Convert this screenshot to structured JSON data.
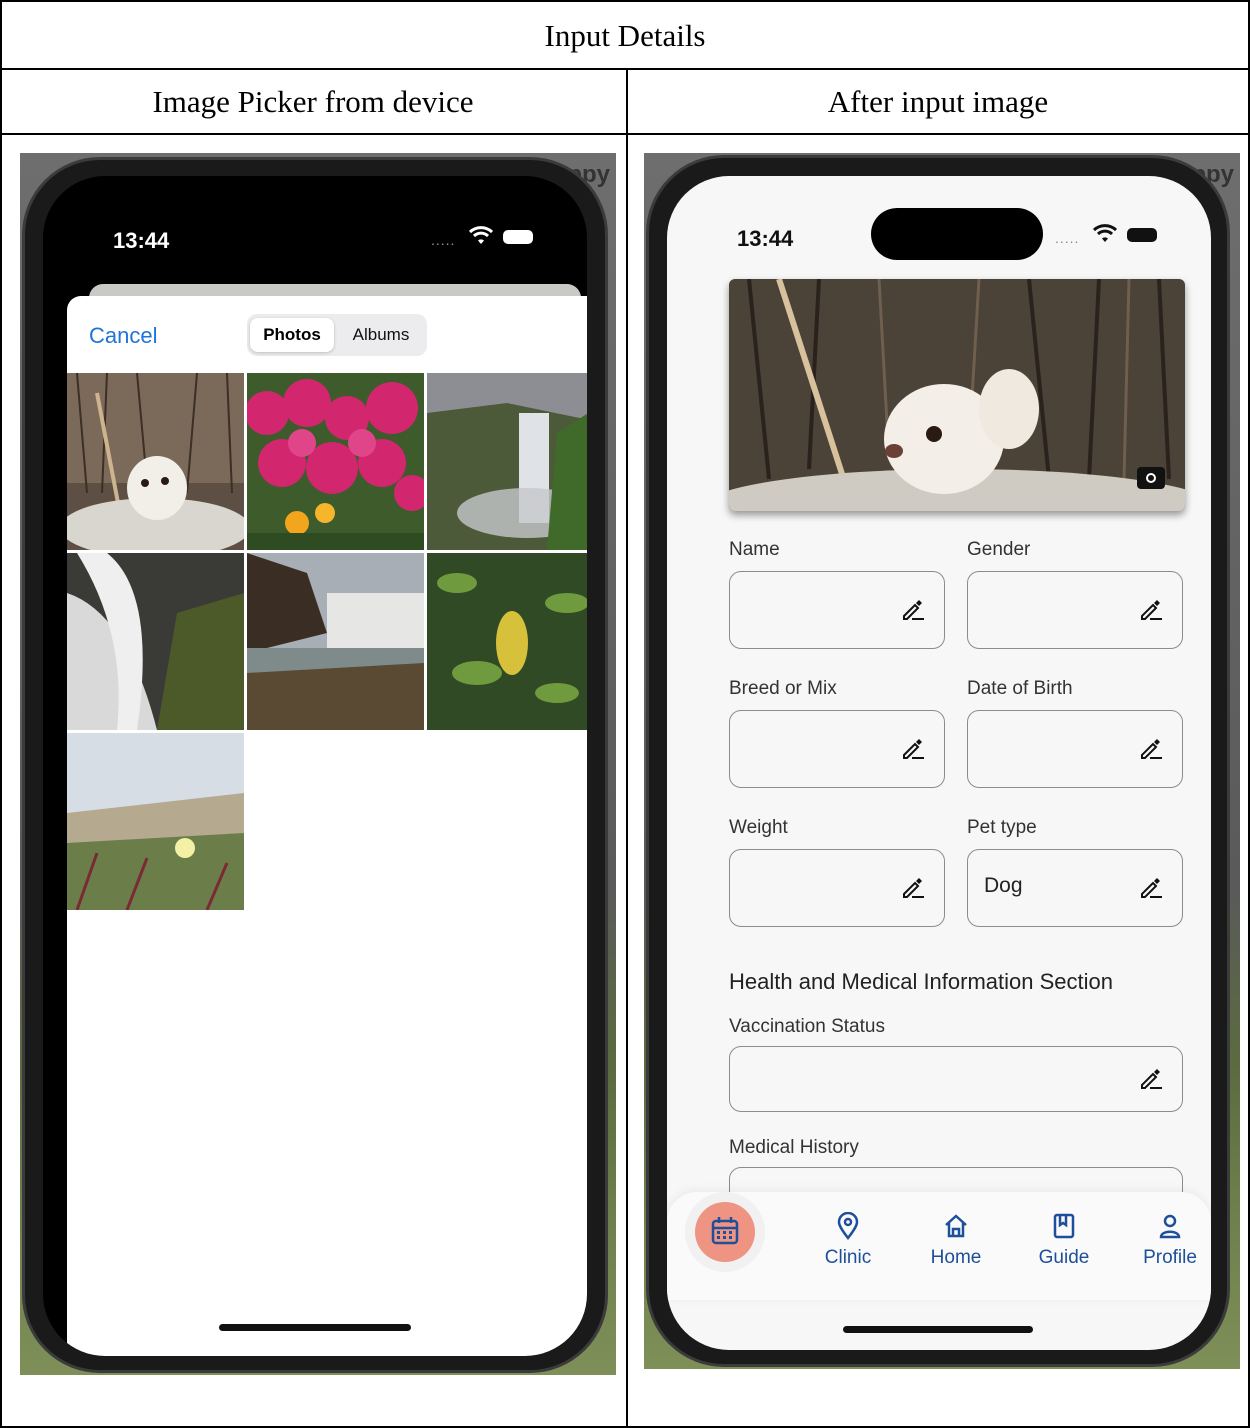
{
  "table": {
    "title": "Input Details",
    "col_left": "Image Picker from device",
    "col_right": "After input image"
  },
  "left_phone": {
    "time": "13:44",
    "signal_dots": ".....",
    "background_peek_text": "appy",
    "cancel_label": "Cancel",
    "segments": [
      "Photos",
      "Albums"
    ],
    "selected_segment": "Photos",
    "photos": [
      "chihuahua in basket",
      "pink flowers",
      "waterfall valley",
      "waterfall rocks",
      "waterfall cliff",
      "green leaves",
      "dune flowers"
    ]
  },
  "right_phone": {
    "time": "13:44",
    "signal_dots": ".....",
    "background_peek_text": "appy",
    "fields": {
      "name": {
        "label": "Name",
        "value": ""
      },
      "gender": {
        "label": "Gender",
        "value": ""
      },
      "breed": {
        "label": "Breed or Mix",
        "value": ""
      },
      "dob": {
        "label": "Date of Birth",
        "value": ""
      },
      "weight": {
        "label": "Weight",
        "value": ""
      },
      "pet_type": {
        "label": "Pet type",
        "value": "Dog"
      },
      "vaccination": {
        "label": "Vaccination Status",
        "value": ""
      },
      "medical_history": {
        "label": "Medical History",
        "value": ""
      }
    },
    "section_title": "Health and Medical Information Section",
    "nav": {
      "fab_icon": "calendar-icon",
      "items": [
        "Clinic",
        "Home",
        "Guide",
        "Profile"
      ]
    },
    "colors": {
      "accent": "#1d4f9b",
      "fab": "#ef9383"
    }
  }
}
